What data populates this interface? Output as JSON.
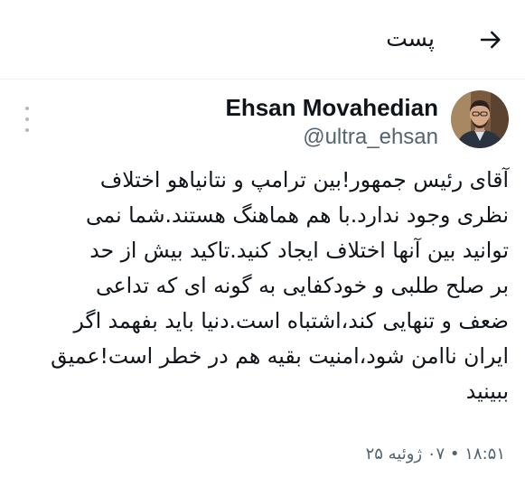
{
  "header": {
    "title": "پست",
    "back_icon": "arrow-right-icon"
  },
  "author": {
    "name": "Ehsan Movahedian",
    "handle": "@ultra_ehsan",
    "avatar_icon": "avatar-photo"
  },
  "tweet": {
    "text": "آقای رئیس جمهور!بین ترامپ و نتانیاهو اختلاف\nنظری وجود ندارد.با هم هماهنگ هستند.شما نمی\nتوانید بین آنها اختلاف ایجاد کنید.تاکید بیش از حد\nبر صلح طلبی و خودکفایی به گونه ای که تداعی\nضعف و تنهایی کند،اشتباه است.دنیا باید بفهمد اگر\nایران ناامن شود،امنیت بقیه هم در خطر است!عمیق\nببینید",
    "timestamp": "۱۸:۵۱ • ۰۷ ژوئیه ۲۵"
  },
  "colors": {
    "text_primary": "#0f1419",
    "text_secondary": "#536471",
    "divider": "#eff3f4"
  }
}
